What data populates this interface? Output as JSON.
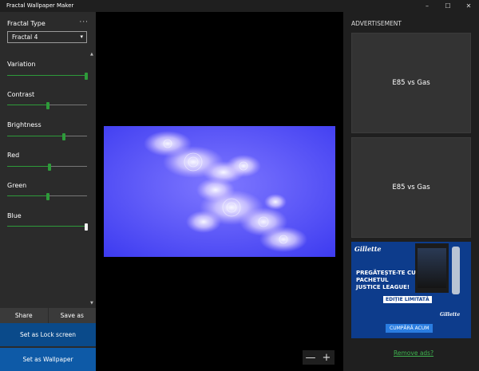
{
  "window": {
    "title": "Fractal Wallpaper Maker",
    "minimize": "–",
    "maximize": "☐",
    "close": "✕"
  },
  "left": {
    "fractal_type_label": "Fractal Type",
    "more": "···",
    "fractal_type_value": "Fractal 4",
    "sliders": [
      {
        "label": "Variation",
        "value": 0.99
      },
      {
        "label": "Contrast",
        "value": 0.51
      },
      {
        "label": "Brightness",
        "value": 0.71
      },
      {
        "label": "Red",
        "value": 0.53
      },
      {
        "label": "Green",
        "value": 0.51
      },
      {
        "label": "Blue",
        "value": 0.99
      }
    ],
    "share": "Share",
    "save_as": "Save as",
    "set_lock": "Set as Lock screen",
    "set_wallpaper": "Set as Wallpaper"
  },
  "center": {
    "zoom_out": "—",
    "zoom_in": "+"
  },
  "right": {
    "ad_header": "ADVERTISEMENT",
    "ad1": "E85 vs Gas",
    "ad2": "E85 vs Gas",
    "gillette": {
      "logo": "Gillette",
      "headline_1": "PREGĂTEȘTE-TE CU",
      "headline_2": "PACHETUL",
      "headline_3": "JUSTICE LEAGUE!",
      "badge": "EDIȚIE LIMITATĂ",
      "cta": "CUMPĂRĂ ACUM",
      "logo_small": "Gillette"
    },
    "remove_ads": "Remove ads?"
  },
  "colors": {
    "accent_green": "#2e9a3a",
    "blue_button": "#0e5aa7",
    "blue_button_dark": "#0a4a8a"
  }
}
